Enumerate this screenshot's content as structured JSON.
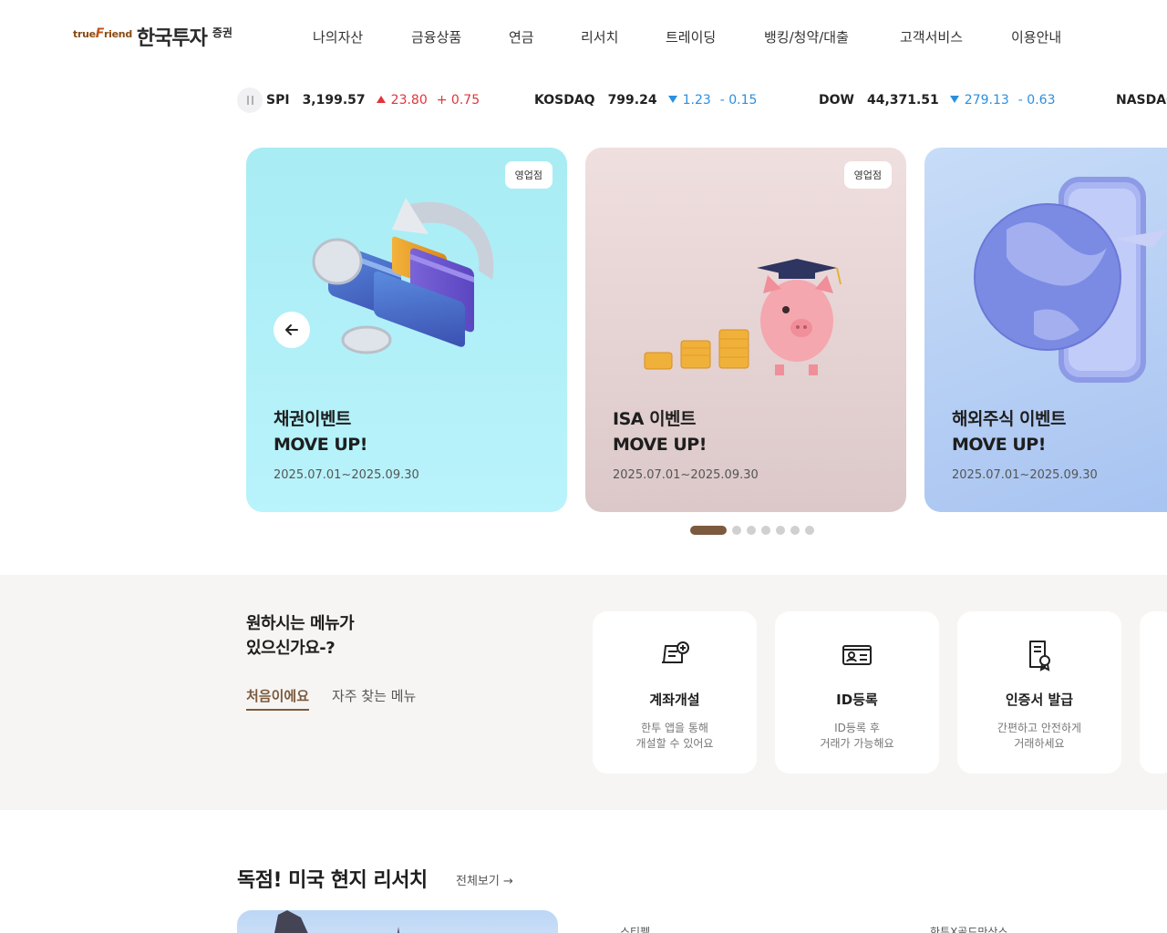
{
  "header": {
    "logo_true": "true",
    "logo_f": "F",
    "logo_riend": "riend",
    "logo_name": "한국투자",
    "logo_sub": "증권",
    "nav": [
      "나의자산",
      "금융상품",
      "연금",
      "리서치",
      "트레이딩",
      "뱅킹/청약/대출",
      "고객서비스",
      "이용안내"
    ]
  },
  "ticker": {
    "items": [
      {
        "name": "SPI",
        "value": "3,199.57",
        "dir": "up",
        "change": "23.80",
        "rate": "+ 0.75"
      },
      {
        "name": "KOSDAQ",
        "value": "799.24",
        "dir": "down",
        "change": "1.23",
        "rate": "- 0.15"
      },
      {
        "name": "DOW",
        "value": "44,371.51",
        "dir": "down",
        "change": "279.13",
        "rate": "- 0.63"
      },
      {
        "name": "NASDAQ",
        "value": "",
        "dir": "",
        "change": "",
        "rate": ""
      }
    ],
    "colors": {
      "up": "#e0353a",
      "down": "#2b8fe0"
    }
  },
  "carousel": {
    "cards": [
      {
        "badge": "영업점",
        "title1": "채권이벤트",
        "title2": "MOVE UP!",
        "date": "2025.07.01~2025.09.30"
      },
      {
        "badge": "영업점",
        "title1": "ISA 이벤트",
        "title2": "MOVE UP!",
        "date": "2025.07.01~2025.09.30"
      },
      {
        "badge": "",
        "title1": "해외주식 이벤트",
        "title2": "MOVE UP!",
        "date": "2025.07.01~2025.09.30"
      }
    ],
    "prev_icon": "arrow-left-icon",
    "active_index": 0,
    "page_count": 8
  },
  "menu": {
    "question_line1": "원하시는 메뉴가",
    "question_line2": "있으신가요-?",
    "tab_first": "처음이에요",
    "tab_frequent": "자주 찾는 메뉴",
    "cards": [
      {
        "icon": "account-open-icon",
        "title": "계좌개설",
        "desc": "한투 앱을 통해\n개설할 수 있어요"
      },
      {
        "icon": "id-card-icon",
        "title": "ID등록",
        "desc": "ID등록 후\n거래가 가능해요"
      },
      {
        "icon": "certificate-icon",
        "title": "인증서 발급",
        "desc": "간편하고 안전하게\n거래하세요"
      }
    ]
  },
  "research": {
    "title": "독점! 미국 현지 리서치",
    "more": "전체보기 →",
    "label1": "스티펠",
    "label2": "한투X골드만삭스"
  },
  "brand_color": "#7b5a3d"
}
